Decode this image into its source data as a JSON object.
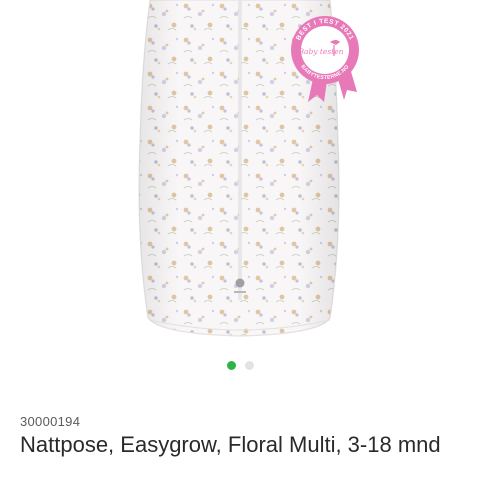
{
  "product": {
    "sku": "30000194",
    "title": "Nattpose, Easygrow, Floral Multi, 3-18 mnd",
    "image_icon": "sleeping-bag-image"
  },
  "badge": {
    "line1": "BEST I TEST 2021",
    "brand": "Baby testen",
    "site": "BABYTESTERNE.NO",
    "color": "#e879b8"
  },
  "gallery": {
    "dot_count": 2,
    "active_index": 0,
    "active_color": "#2eb24a",
    "inactive_color": "#e3e3e3"
  }
}
